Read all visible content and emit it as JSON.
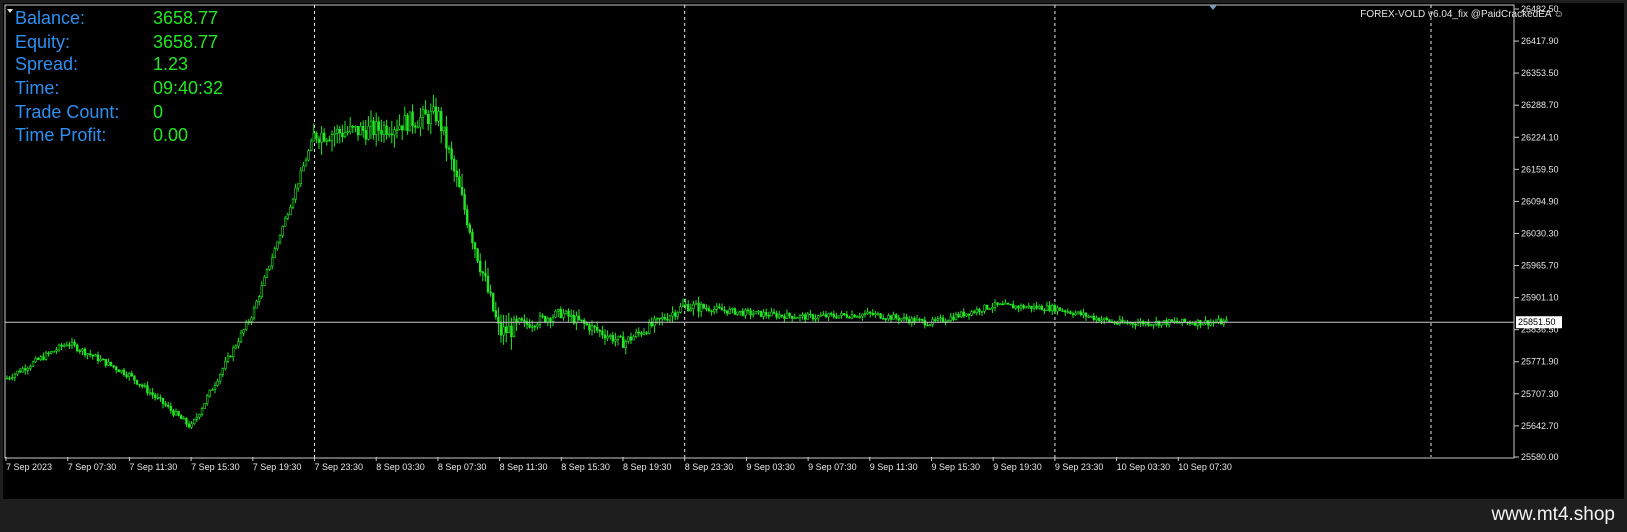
{
  "info_panel": [
    {
      "label": "Balance:",
      "value": "3658.77"
    },
    {
      "label": "Equity:",
      "value": "3658.77"
    },
    {
      "label": "Spread:",
      "value": "1.23"
    },
    {
      "label": "Time:",
      "value": "09:40:32"
    },
    {
      "label": "Trade Count:",
      "value": "0"
    },
    {
      "label": "Time Profit:",
      "value": "0.00"
    }
  ],
  "ea_label": "FOREX-VOLD v6.04_fix @PaidCrackedEA",
  "ea_icon": "smiley-icon",
  "watermark": "www.mt4.shop",
  "colors": {
    "background": "#000000",
    "candle": "#22e622",
    "label": "#2f8ff0",
    "value": "#22e622",
    "text": "#e6e6e6"
  },
  "chart_data": {
    "type": "candlestick",
    "ylim": [
      25580.0,
      26482.5
    ],
    "y_ticks": [
      "26482.50",
      "26417.90",
      "26353.50",
      "26288.70",
      "26224.10",
      "26159.50",
      "26094.90",
      "26030.30",
      "25965.70",
      "25901.10",
      "25836.50",
      "25771.90",
      "25707.30",
      "25642.70",
      "25580.00"
    ],
    "current_price": "25851.50",
    "x_ticks": [
      "7 Sep 2023",
      "7 Sep 07:30",
      "7 Sep 11:30",
      "7 Sep 15:30",
      "7 Sep 19:30",
      "7 Sep 23:30",
      "8 Sep 03:30",
      "8 Sep 07:30",
      "8 Sep 11:30",
      "8 Sep 15:30",
      "8 Sep 19:30",
      "8 Sep 23:30",
      "9 Sep 03:30",
      "9 Sep 07:30",
      "9 Sep 11:30",
      "9 Sep 15:30",
      "9 Sep 19:30",
      "9 Sep 23:30",
      "10 Sep 03:30",
      "10 Sep 07:30"
    ],
    "period_separators": [
      "7 Sep 23:30",
      "8 Sep 23:30",
      "9 Sep 23:30"
    ],
    "price_path": [
      {
        "x": "7 Sep 2023",
        "y": 25738
      },
      {
        "x": "7 Sep 07:30",
        "y": 25810
      },
      {
        "x": "7 Sep 11:30",
        "y": 25745
      },
      {
        "x": "7 Sep 15:30",
        "y": 25640
      },
      {
        "x": "7 Sep 19:30",
        "y": 25870
      },
      {
        "x": "7 Sep 23:30",
        "y": 26230
      },
      {
        "x": "8 Sep 03:30",
        "y": 26240
      },
      {
        "x": "8 Sep 07:30",
        "y": 26270
      },
      {
        "x": "8 Sep 11:30",
        "y": 25830
      },
      {
        "x": "8 Sep 15:30",
        "y": 25870
      },
      {
        "x": "8 Sep 19:30",
        "y": 25810
      },
      {
        "x": "8 Sep 23:30",
        "y": 25885
      },
      {
        "x": "9 Sep 03:30",
        "y": 25870
      },
      {
        "x": "9 Sep 07:30",
        "y": 25862
      },
      {
        "x": "9 Sep 11:30",
        "y": 25868
      },
      {
        "x": "9 Sep 15:30",
        "y": 25850
      },
      {
        "x": "9 Sep 19:30",
        "y": 25885
      },
      {
        "x": "9 Sep 23:30",
        "y": 25880
      },
      {
        "x": "10 Sep 03:30",
        "y": 25850
      },
      {
        "x": "10 Sep 07:30",
        "y": 25851.5
      }
    ]
  }
}
